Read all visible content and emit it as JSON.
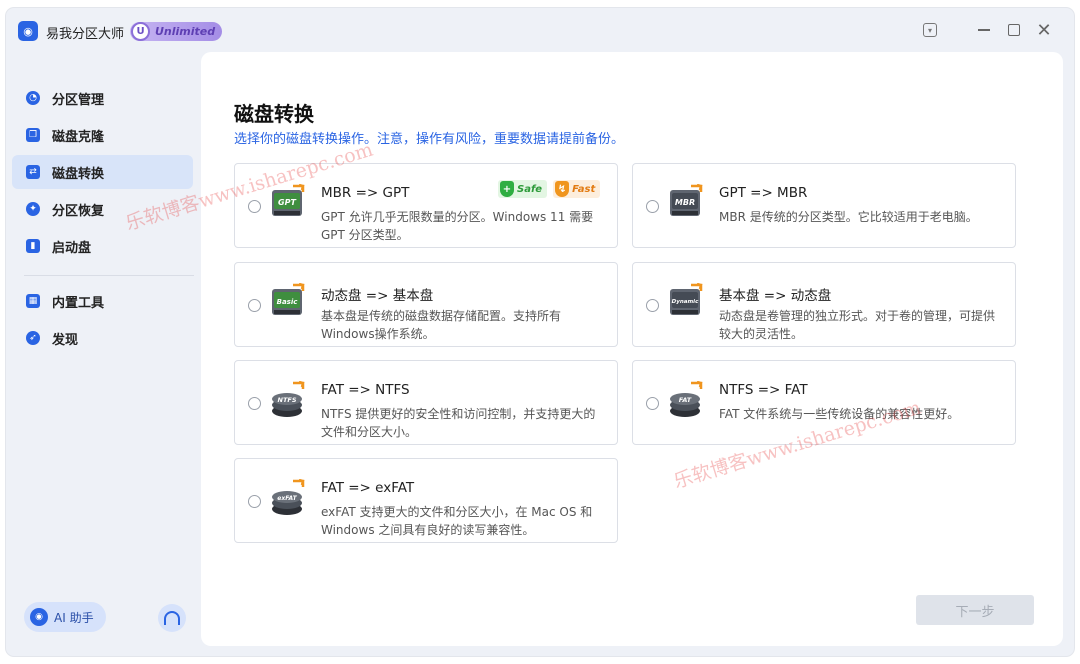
{
  "app": {
    "title": "易我分区大师",
    "logo_glyph": "◉",
    "badge_letter": "U",
    "badge_text": "Unlimited"
  },
  "window_controls": [
    "download-icon",
    "minimize-icon",
    "maximize-icon",
    "close-icon"
  ],
  "sidebar": {
    "items": [
      {
        "label": "分区管理",
        "icon": "pie-chart-icon"
      },
      {
        "label": "磁盘克隆",
        "icon": "disk-clone-icon"
      },
      {
        "label": "磁盘转换",
        "icon": "disk-convert-icon",
        "active": true
      },
      {
        "label": "分区恢复",
        "icon": "partition-recovery-icon"
      },
      {
        "label": "启动盘",
        "icon": "usb-drive-icon"
      },
      {
        "label": "内置工具",
        "icon": "toolbox-icon"
      },
      {
        "label": "发现",
        "icon": "compass-icon"
      }
    ],
    "ai_button": "AI 助手",
    "support_icon": "headset-icon"
  },
  "main": {
    "title": "磁盘转换",
    "subtitle": "选择你的磁盘转换操作。注意，操作有风险，重要数据请提前备份。",
    "tags": {
      "safe": "Safe",
      "fast": "Fast"
    },
    "options": [
      {
        "title": "MBR => GPT",
        "desc": "GPT 允许几乎无限数量的分区。Windows 11 需要 GPT 分区类型。",
        "icon_label": "GPT",
        "icon_kind": "disk"
      },
      {
        "title": "GPT => MBR",
        "desc": "MBR 是传统的分区类型。它比较适用于老电脑。",
        "icon_label": "MBR",
        "icon_kind": "disk"
      },
      {
        "title": "动态盘 => 基本盘",
        "desc": "基本盘是传统的磁盘数据存储配置。支持所有 Windows操作系统。",
        "icon_label": "Basic",
        "icon_kind": "disk"
      },
      {
        "title": "基本盘 => 动态盘",
        "desc": "动态盘是卷管理的独立形式。对于卷的管理，可提供较大的灵活性。",
        "icon_label": "Dynamic",
        "icon_kind": "disk"
      },
      {
        "title": "FAT => NTFS",
        "desc": "NTFS 提供更好的安全性和访问控制，并支持更大的文件和分区大小。",
        "icon_label": "NTFS",
        "icon_kind": "stack"
      },
      {
        "title": "NTFS => FAT",
        "desc": "FAT 文件系统与一些传统设备的兼容性更好。",
        "icon_label": "FAT",
        "icon_kind": "stack"
      },
      {
        "title": "FAT => exFAT",
        "desc": "exFAT 支持更大的文件和分区大小，在 Mac OS 和 Windows 之间具有良好的读写兼容性。",
        "icon_label": "exFAT",
        "icon_kind": "stack"
      }
    ],
    "next_button": "下一步"
  },
  "watermark": "乐软博客www.isharepc.com",
  "colors": {
    "accent": "#2a64e3",
    "sidebar_active": "#d8e4f9",
    "safe": "#2fae42",
    "fast": "#f0951e"
  }
}
